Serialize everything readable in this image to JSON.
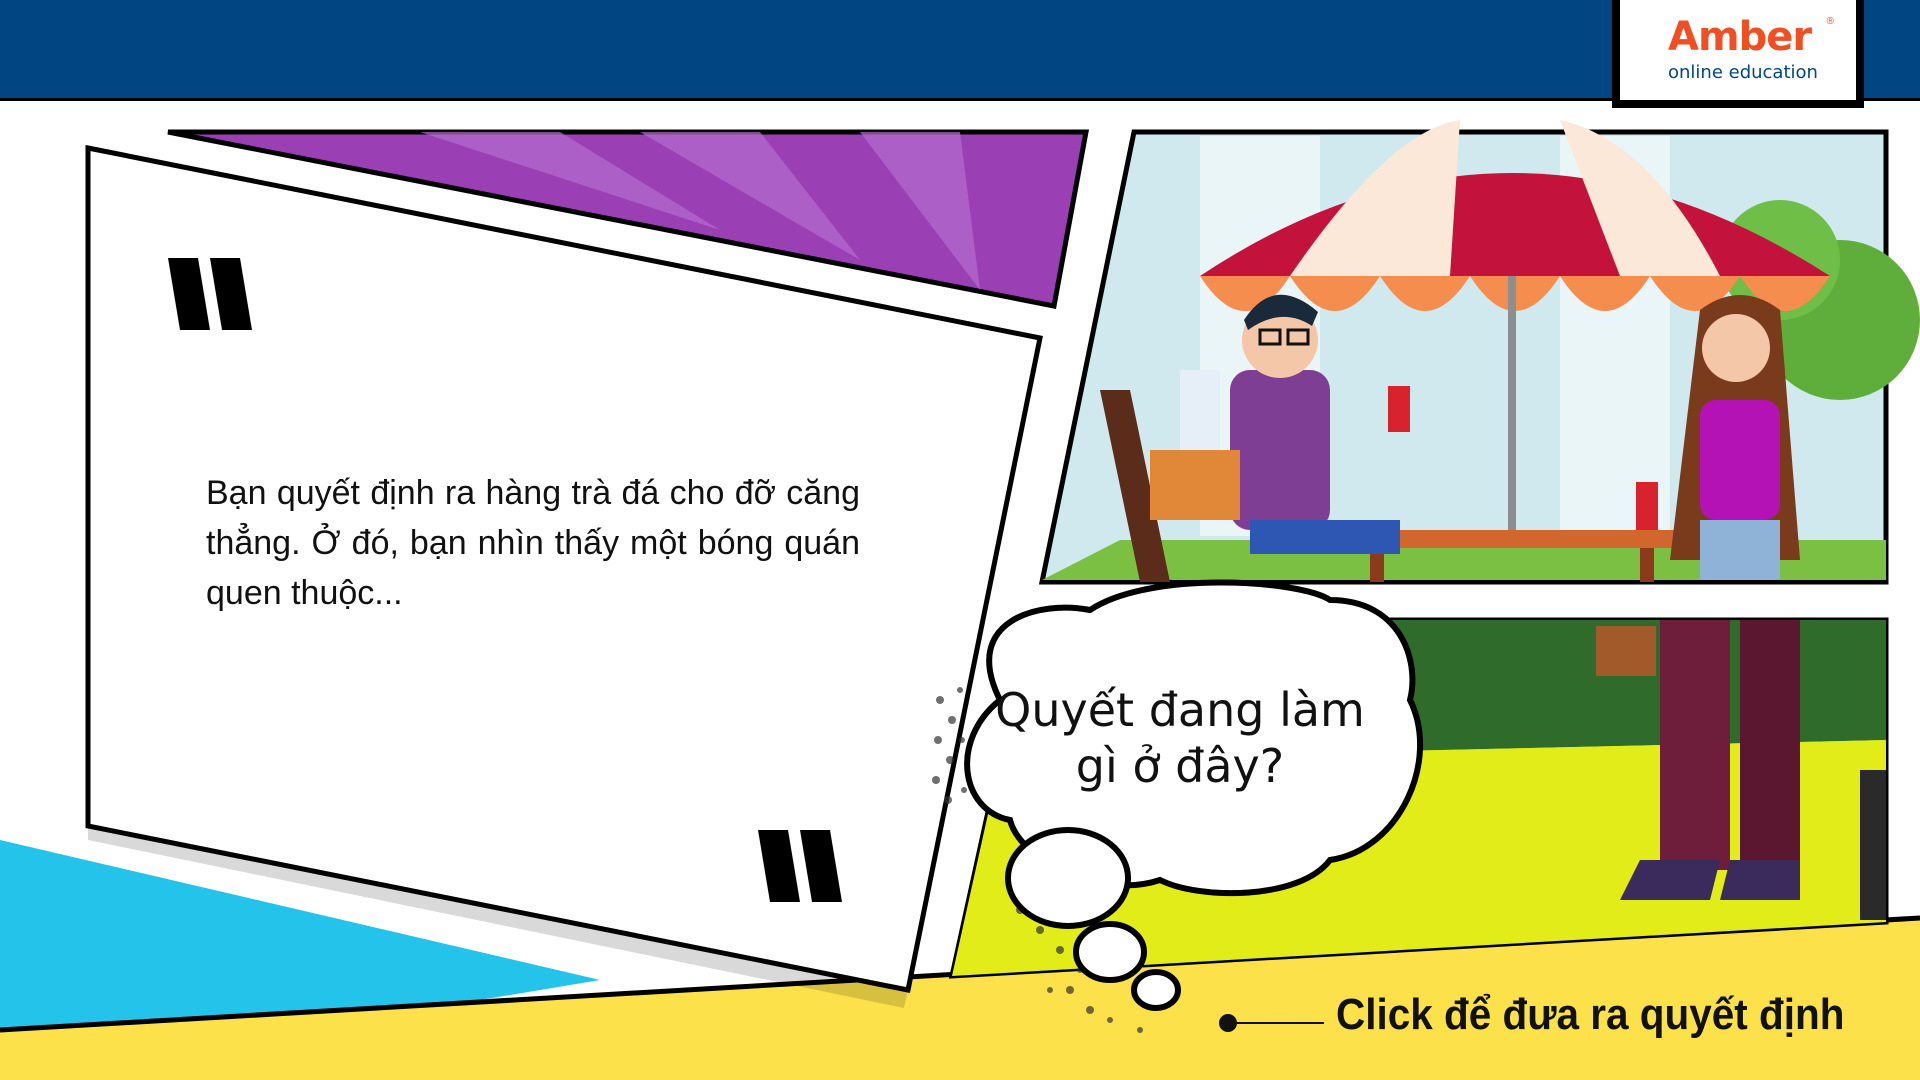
{
  "brand": {
    "name": "Amber",
    "tagline": "online education",
    "registered": "®"
  },
  "narration": {
    "text": "Bạn quyết định ra hàng trà đá cho đỡ căng thẳng. Ở đó, bạn nhìn thấy một bóng quán quen thuộc..."
  },
  "thought": {
    "text": "Quyết đang làm gì ở đây?"
  },
  "cta": {
    "label": "Click để đưa ra quyết định"
  },
  "colors": {
    "header": "#014583",
    "logo_orange": "#f04e23",
    "purple": "#9b3fb5",
    "cyan": "#23c3ea",
    "yellow": "#fde14b"
  },
  "icons": [
    "quote-open-icon",
    "quote-close-icon",
    "cta-dot-icon",
    "umbrella-illustration",
    "man-character",
    "woman-character"
  ]
}
